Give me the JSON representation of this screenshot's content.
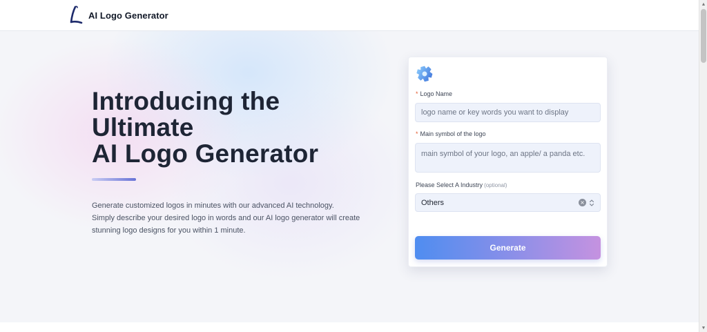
{
  "header": {
    "brand_name": "AI Logo Generator",
    "logo_icon": "script-l-logo"
  },
  "hero": {
    "headline": [
      "Introducing the",
      "Ultimate",
      "AI Logo Generator"
    ],
    "description": [
      "Generate customized logos in minutes with our advanced AI technology.",
      "Simply describe your desired logo in words and our AI logo generator will create",
      "stunning logo designs for you within 1 minute."
    ]
  },
  "form": {
    "icon": "gear-icon",
    "logo_name": {
      "required_mark": "*",
      "label": "Logo Name",
      "value": "",
      "placeholder": "logo name or key words you want to display"
    },
    "main_symbol": {
      "required_mark": "*",
      "label": "Main symbol of the logo",
      "value": "",
      "placeholder": "main symbol of your logo, an apple/ a panda etc."
    },
    "industry": {
      "label": "Please Select A Industry",
      "optional_note": "(optional)",
      "selected": "Others"
    },
    "generate_label": "Generate"
  },
  "colors": {
    "button_start": "#4f8df0",
    "button_end": "#c592e0",
    "required_mark": "#e35a2f",
    "headline": "#1e2535"
  }
}
